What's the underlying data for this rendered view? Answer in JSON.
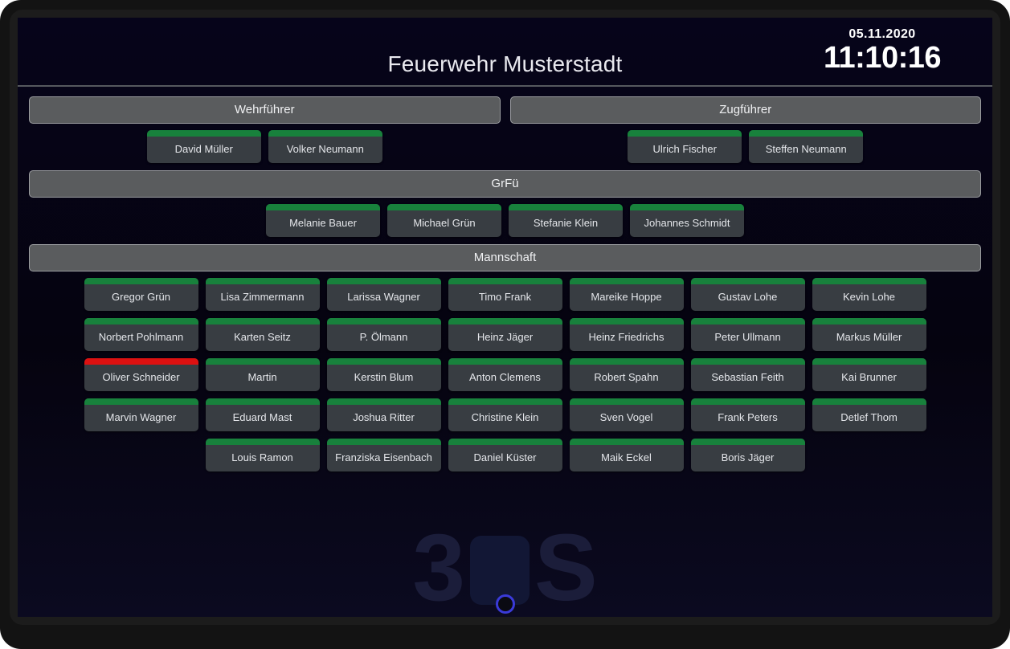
{
  "header": {
    "title": "Feuerwehr Musterstadt",
    "date": "05.11.2020",
    "time": "11:10:16"
  },
  "watermark": {
    "left_glyph": "3",
    "right_glyph": "S"
  },
  "colors": {
    "status_available": "#18813c",
    "status_unavailable": "#dd1111",
    "card_body": "#383d42",
    "section_header": "#5a5c5e",
    "screen_background": "#05030f"
  },
  "sections": [
    {
      "id": "wehrfuehrer",
      "label": "Wehrführer",
      "members": [
        {
          "name": "David Müller",
          "status": "green"
        },
        {
          "name": "Volker Neumann",
          "status": "green"
        }
      ]
    },
    {
      "id": "zugfuehrer",
      "label": "Zugführer",
      "members": [
        {
          "name": "Ulrich Fischer",
          "status": "green"
        },
        {
          "name": "Steffen Neumann",
          "status": "green"
        }
      ]
    },
    {
      "id": "grfue",
      "label": "GrFü",
      "members": [
        {
          "name": "Melanie Bauer",
          "status": "green"
        },
        {
          "name": "Michael Grün",
          "status": "green"
        },
        {
          "name": "Stefanie Klein",
          "status": "green"
        },
        {
          "name": "Johannes Schmidt",
          "status": "green"
        }
      ]
    },
    {
      "id": "mannschaft",
      "label": "Mannschaft",
      "rows": [
        [
          {
            "name": "Gregor Grün",
            "status": "green"
          },
          {
            "name": "Lisa Zimmermann",
            "status": "green"
          },
          {
            "name": "Larissa Wagner",
            "status": "green"
          },
          {
            "name": "Timo Frank",
            "status": "green"
          },
          {
            "name": "Mareike Hoppe",
            "status": "green"
          },
          {
            "name": "Gustav Lohe",
            "status": "green"
          },
          {
            "name": "Kevin Lohe",
            "status": "green"
          }
        ],
        [
          {
            "name": "Norbert Pohlmann",
            "status": "green"
          },
          {
            "name": "Karten Seitz",
            "status": "green"
          },
          {
            "name": "P. Ölmann",
            "status": "green"
          },
          {
            "name": "Heinz Jäger",
            "status": "green"
          },
          {
            "name": "Heinz Friedrichs",
            "status": "green"
          },
          {
            "name": "Peter Ullmann",
            "status": "green"
          },
          {
            "name": "Markus Müller",
            "status": "green"
          }
        ],
        [
          {
            "name": "Oliver Schneider",
            "status": "red"
          },
          {
            "name": "Martin",
            "status": "green"
          },
          {
            "name": "Kerstin Blum",
            "status": "green"
          },
          {
            "name": "Anton Clemens",
            "status": "green"
          },
          {
            "name": "Robert Spahn",
            "status": "green"
          },
          {
            "name": "Sebastian Feith",
            "status": "green"
          },
          {
            "name": "Kai Brunner",
            "status": "green"
          }
        ],
        [
          {
            "name": "Marvin Wagner",
            "status": "green"
          },
          {
            "name": "Eduard Mast",
            "status": "green"
          },
          {
            "name": "Joshua Ritter",
            "status": "green"
          },
          {
            "name": "Christine Klein",
            "status": "green"
          },
          {
            "name": "Sven Vogel",
            "status": "green"
          },
          {
            "name": "Frank Peters",
            "status": "green"
          },
          {
            "name": "Detlef Thom",
            "status": "green"
          }
        ],
        [
          {
            "name": "Louis Ramon",
            "status": "green"
          },
          {
            "name": "Franziska Eisenbach",
            "status": "green"
          },
          {
            "name": "Daniel Küster",
            "status": "green"
          },
          {
            "name": "Maik Eckel",
            "status": "green"
          },
          {
            "name": "Boris Jäger",
            "status": "green"
          }
        ]
      ]
    }
  ]
}
